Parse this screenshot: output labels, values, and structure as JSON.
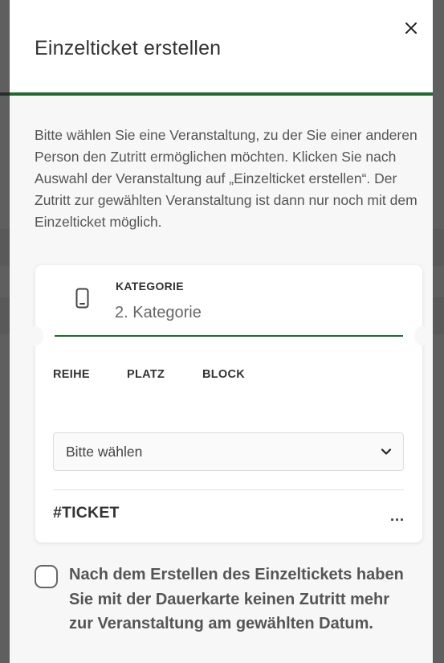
{
  "modal": {
    "title": "Einzelticket erstellen",
    "close_icon": "close-icon",
    "intro": "Bitte wählen Sie eine Veranstaltung, zu der Sie einer anderen Person den Zutritt ermöglichen möchten. Klicken Sie nach Auswahl der Veranstaltung auf „Einzelticket erstellen“. Der Zutritt zur gewählten Veranstaltung ist dann nur noch mit dem Einzelticket möglich."
  },
  "ticket": {
    "category_icon": "phone-icon",
    "category_label": "KATEGORIE",
    "category_value": "2. Kategorie",
    "seat_headers": {
      "row": "REIHE",
      "place": "PLATZ",
      "block": "BLOCK"
    },
    "select": {
      "value": "Bitte wählen",
      "icon": "chevron-down-icon"
    },
    "number": "#TICKET",
    "more": "..."
  },
  "confirm": {
    "checked": false,
    "text": "Nach dem Erstellen des Einzeltickets haben Sie mit der Dauerkarte keinen Zutritt mehr zur Veranstaltung am gewählten Datum."
  },
  "colors": {
    "accent": "#1d6b2e",
    "text": "#333333",
    "muted_text": "#555555",
    "body_background": "#f7f7f7"
  }
}
